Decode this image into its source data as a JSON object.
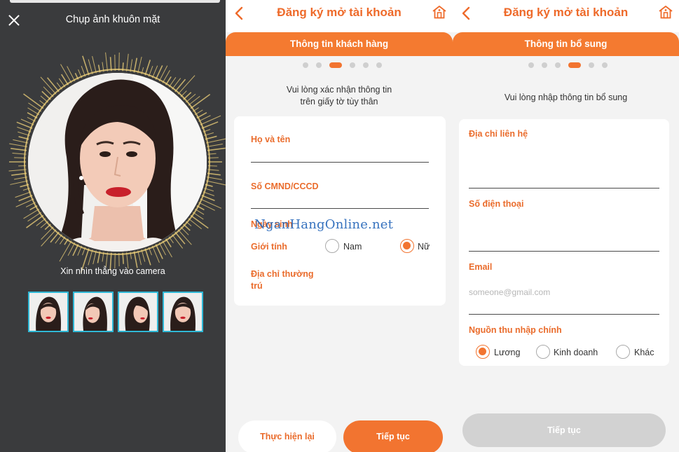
{
  "face_capture": {
    "title": "Chụp ảnh khuôn mặt",
    "hint": "Xin nhìn thẳng vào camera",
    "close_icon": "close-icon",
    "thumbnails": [
      "face-front",
      "face-left",
      "face-right",
      "face-front-2"
    ]
  },
  "customer_info": {
    "header_title": "Đăng ký mở tài khoản",
    "section_title": "Thông tin khách hàng",
    "step_current": 3,
    "step_total": 6,
    "subtitle_line1": "Vui lòng xác nhận thông tin",
    "subtitle_line2": "trên giấy tờ tùy thân",
    "fields": {
      "full_name": "Họ và tên",
      "id_number": "Số CMND/CCCD",
      "dob": "Ngày sinh",
      "gender": "Giới tính",
      "address_line1": "Địa chỉ thường",
      "address_line2": "trú"
    },
    "gender_options": [
      "Nam",
      "Nữ"
    ],
    "gender_selected": "Nữ",
    "retry_button": "Thực hiện lại",
    "continue_button": "Tiếp tục"
  },
  "additional_info": {
    "header_title": "Đăng ký mở tài khoản",
    "section_title": "Thông tin bổ sung",
    "step_current": 4,
    "step_total": 6,
    "subtitle": "Vui lòng nhập thông tin bổ sung",
    "fields": {
      "contact_address": "Địa chỉ liên hệ",
      "phone": "Số điện thoại",
      "email": "Email",
      "income_source": "Nguồn thu nhập chính"
    },
    "email_placeholder": "someone@gmail.com",
    "income_options": [
      "Lương",
      "Kinh doanh",
      "Khác"
    ],
    "income_selected": "Lương",
    "continue_button": "Tiếp tục"
  },
  "watermark": "NganHangOnline.net",
  "colors": {
    "accent": "#f27430",
    "header_text": "#ee6a2a",
    "dark_bg": "#3a3b3d",
    "thumb_border": "#2fb8d6",
    "gold_rays": "#f0d27a",
    "disabled_button": "#d2d2d2"
  }
}
